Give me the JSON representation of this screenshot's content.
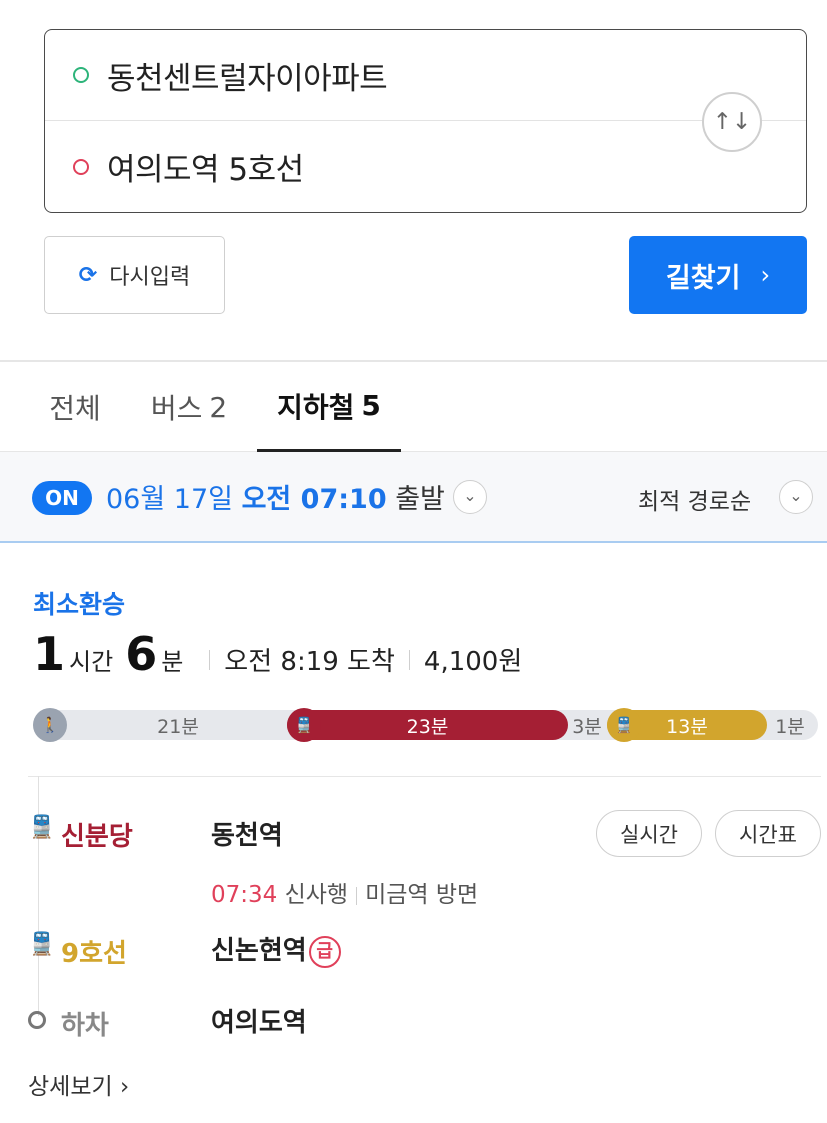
{
  "search": {
    "origin": "동천센트럴자이아파트",
    "destination": "여의도역 5호선",
    "swap_icon": "↑↓"
  },
  "buttons": {
    "reset_label": "다시입력",
    "find_label": "길찾기"
  },
  "tabs": [
    {
      "label": "전체",
      "count": ""
    },
    {
      "label": "버스",
      "count": "2"
    },
    {
      "label": "지하철",
      "count": "5"
    }
  ],
  "departure": {
    "on_badge": "ON",
    "date": "06월 17일",
    "time": "오전 07:10",
    "suffix": "출발",
    "sort_label": "최적 경로순"
  },
  "route": {
    "type_label": "최소환승",
    "hours": "1",
    "hours_unit": "시간",
    "minutes": "6",
    "minutes_unit": "분",
    "arrival": "오전 8:19 도착",
    "fare": "4,100원",
    "segments": [
      {
        "kind": "walk",
        "label": "21분"
      },
      {
        "kind": "line5",
        "label": "23분"
      },
      {
        "kind": "gap",
        "label": "3분"
      },
      {
        "kind": "line9",
        "label": "13분"
      },
      {
        "kind": "gap",
        "label": "1분"
      }
    ],
    "steps": [
      {
        "line": "신분당",
        "station": "동천역"
      },
      {
        "line": "9호선",
        "station": "신논현역",
        "badge": "급"
      },
      {
        "line": "하차",
        "station": "여의도역"
      }
    ],
    "first_step_info": {
      "time": "07:34",
      "direction": "신사행",
      "next": "미금역 방면"
    },
    "realtime_label": "실시간",
    "timetable_label": "시간표",
    "detail_label": "상세보기"
  },
  "colors": {
    "accent": "#1276f2",
    "line_sinbundang": "#a51f34",
    "line_9": "#d2a52d",
    "origin_dot": "#2db47a",
    "dest_dot": "#e0405a"
  }
}
